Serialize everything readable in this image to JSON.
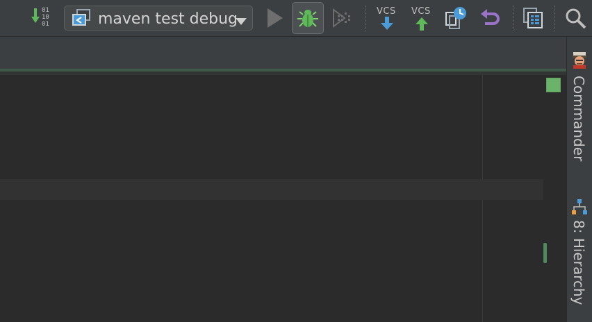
{
  "toolbar": {
    "make_icon": "binary-update-icon",
    "binary_digits": [
      "01",
      "10",
      "01"
    ],
    "run_config": {
      "label": "maven test debug",
      "icon": "run-configuration-icon",
      "dropdown_icon": "chevron-down-icon"
    },
    "run_icon": "run-icon",
    "debug_icon": "debug-bug-icon",
    "coverage_icon": "coverage-icon",
    "vcs_update": {
      "label": "VCS",
      "icon": "arrow-down-icon"
    },
    "vcs_commit": {
      "label": "VCS",
      "icon": "arrow-up-icon"
    },
    "history_icon": "history-icon",
    "revert_icon": "revert-icon",
    "structure_icon": "project-structure-icon",
    "search_icon": "search-icon"
  },
  "right_panel": {
    "commander": {
      "label": "Commander",
      "icon": "commander-icon"
    },
    "hierarchy": {
      "label": "8: Hierarchy",
      "icon": "hierarchy-icon"
    }
  },
  "colors": {
    "background": "#2b2b2b",
    "toolbar": "#3c3f41",
    "accent_green": "#5fb85a",
    "vcs_blue": "#4a9bd8",
    "revert_purple": "#9a73c8",
    "status_ok": "#6bb36b"
  }
}
